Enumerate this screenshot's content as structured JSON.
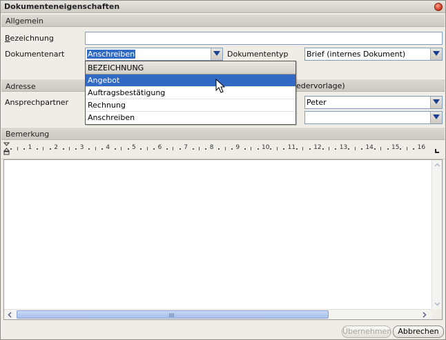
{
  "window": {
    "title": "Dokumenteneigenschaften"
  },
  "sections": {
    "allgemein": "Allgemein",
    "adresse": "Adresse",
    "bemerkung": "Bemerkung"
  },
  "fields": {
    "bezeichnung_label_first": "B",
    "bezeichnung_label_rest": "ezeichnung",
    "bezeichnung_value": "",
    "dokumentenart_label": "Dokumentenart",
    "dokumentenart_value": "Anschreiben",
    "dokumententyp_label": "Dokumententyp",
    "dokumententyp_value": "Brief (internes Dokument)",
    "ansprechpartner_label": "Ansprechpartner",
    "ansprechpartner_value": "Peter",
    "second_combo_value": "",
    "hidden_text_fragment": "edervorlage)"
  },
  "dropdown": {
    "header": "BEZEICHNUNG",
    "options": [
      "Angebot",
      "Auftragsbestätigung",
      "Rechnung",
      "Anschreiben"
    ],
    "highlighted": "Angebot"
  },
  "ruler": {
    "numbers": [
      "1",
      "2",
      "3",
      "4",
      "5",
      "6",
      "7",
      "8",
      "9",
      "10",
      "11",
      "12",
      "13",
      "14",
      "15",
      "16"
    ]
  },
  "footer": {
    "apply_label": "Übernehmen",
    "cancel_label": "Abbrechen"
  },
  "colors": {
    "selection": "#316ac5",
    "scrollbar_thumb": "#a9bfe9",
    "close_button": "#c9341f"
  }
}
